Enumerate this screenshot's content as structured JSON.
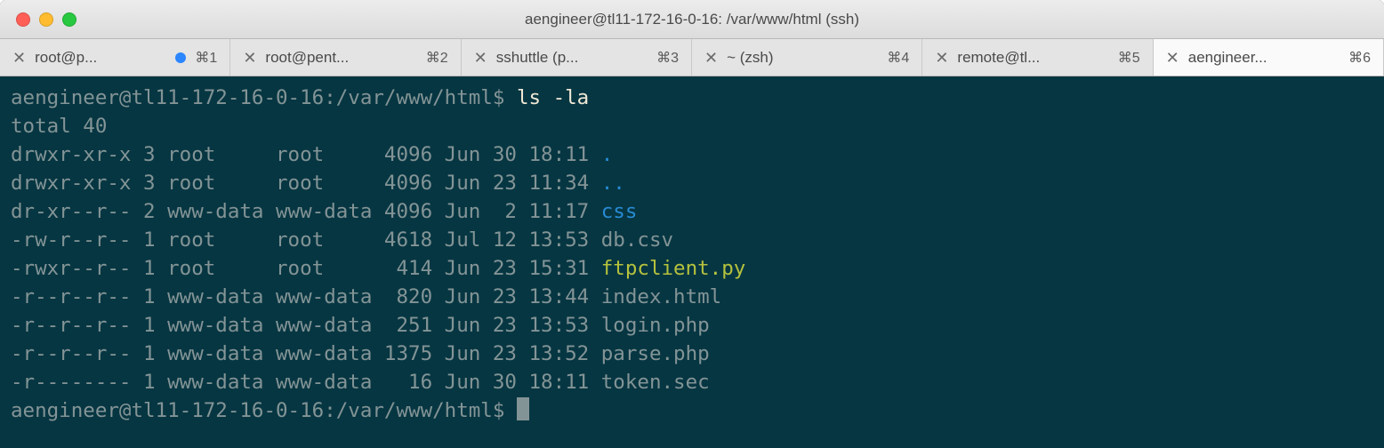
{
  "title": "aengineer@tl11-172-16-0-16: /var/www/html (ssh)",
  "tabs": [
    {
      "label": "root@p...",
      "shortcut": "⌘1",
      "dot": true
    },
    {
      "label": "root@pent...",
      "shortcut": "⌘2",
      "dot": false
    },
    {
      "label": "sshuttle (p...",
      "shortcut": "⌘3",
      "dot": false
    },
    {
      "label": "~ (zsh)",
      "shortcut": "⌘4",
      "dot": false
    },
    {
      "label": "remote@tl...",
      "shortcut": "⌘5",
      "dot": false
    },
    {
      "label": "aengineer...",
      "shortcut": "⌘6",
      "dot": false
    }
  ],
  "active_tab": 5,
  "prompt1": "aengineer@tl11-172-16-0-16:/var/www/html$ ",
  "command1": "ls -la",
  "total_line": "total 40",
  "listing": [
    {
      "perm": "drwxr-xr-x",
      "links": "3",
      "owner": "root    ",
      "group": "root    ",
      "size": "4096",
      "mon": "Jun",
      "day": "30",
      "time": "18:11",
      "name": ".",
      "cls": "blue"
    },
    {
      "perm": "drwxr-xr-x",
      "links": "3",
      "owner": "root    ",
      "group": "root    ",
      "size": "4096",
      "mon": "Jun",
      "day": "23",
      "time": "11:34",
      "name": "..",
      "cls": "blue"
    },
    {
      "perm": "dr-xr--r--",
      "links": "2",
      "owner": "www-data",
      "group": "www-data",
      "size": "4096",
      "mon": "Jun",
      "day": " 2",
      "time": "11:17",
      "name": "css",
      "cls": "blue"
    },
    {
      "perm": "-rw-r--r--",
      "links": "1",
      "owner": "root    ",
      "group": "root    ",
      "size": "4618",
      "mon": "Jul",
      "day": "12",
      "time": "13:53",
      "name": "db.csv",
      "cls": ""
    },
    {
      "perm": "-rwxr--r--",
      "links": "1",
      "owner": "root    ",
      "group": "root    ",
      "size": " 414",
      "mon": "Jun",
      "day": "23",
      "time": "15:31",
      "name": "ftpclient.py",
      "cls": "yellow"
    },
    {
      "perm": "-r--r--r--",
      "links": "1",
      "owner": "www-data",
      "group": "www-data",
      "size": " 820",
      "mon": "Jun",
      "day": "23",
      "time": "13:44",
      "name": "index.html",
      "cls": ""
    },
    {
      "perm": "-r--r--r--",
      "links": "1",
      "owner": "www-data",
      "group": "www-data",
      "size": " 251",
      "mon": "Jun",
      "day": "23",
      "time": "13:53",
      "name": "login.php",
      "cls": ""
    },
    {
      "perm": "-r--r--r--",
      "links": "1",
      "owner": "www-data",
      "group": "www-data",
      "size": "1375",
      "mon": "Jun",
      "day": "23",
      "time": "13:52",
      "name": "parse.php",
      "cls": ""
    },
    {
      "perm": "-r--------",
      "links": "1",
      "owner": "www-data",
      "group": "www-data",
      "size": "  16",
      "mon": "Jun",
      "day": "30",
      "time": "18:11",
      "name": "token.sec",
      "cls": ""
    }
  ],
  "prompt2": "aengineer@tl11-172-16-0-16:/var/www/html$ "
}
